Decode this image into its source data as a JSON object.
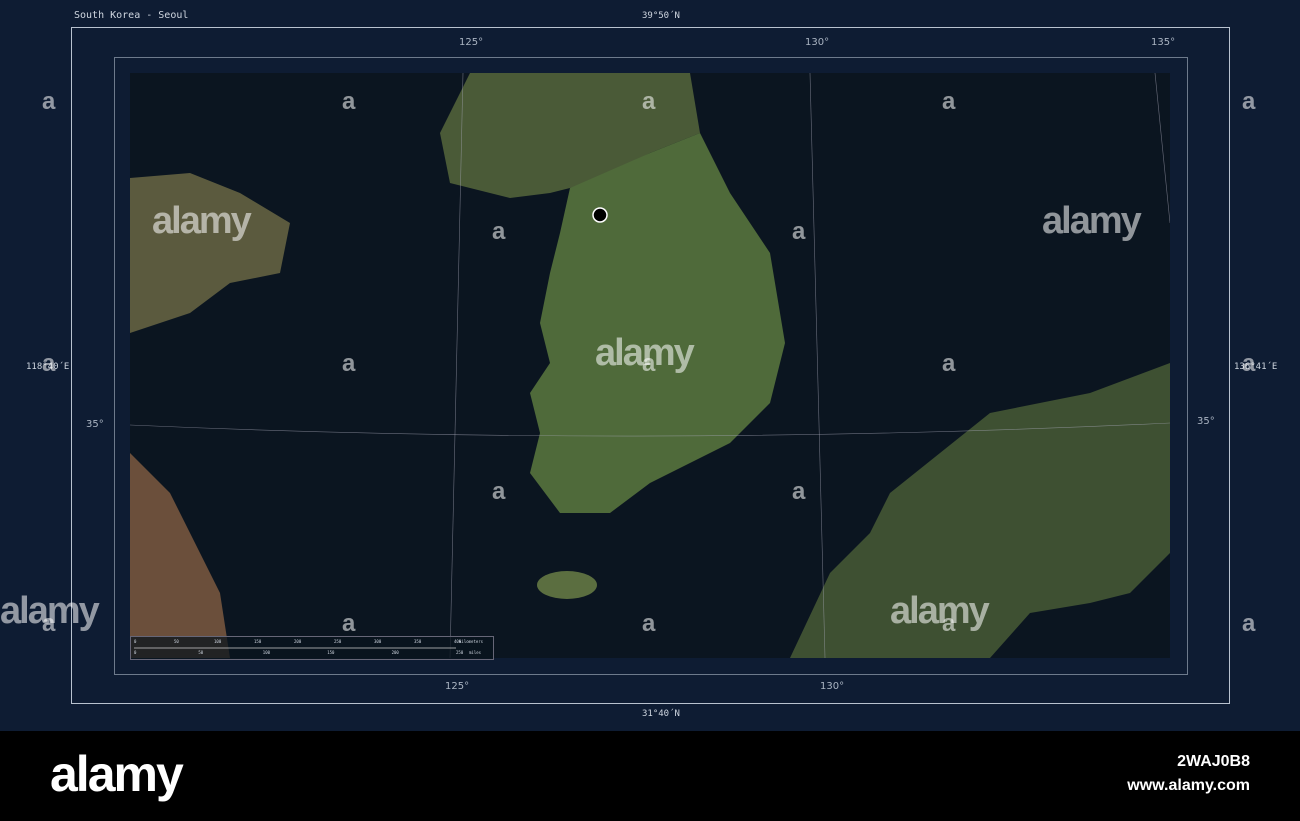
{
  "title": "South Korea - Seoul",
  "coords": {
    "top": "39°50´N",
    "bottom": "31°40´N",
    "left": "118°40´E",
    "right": "136°41´E"
  },
  "graticule": {
    "lon": [
      "125°",
      "130°",
      "135°"
    ],
    "lat": [
      "35°"
    ]
  },
  "scale": {
    "km_ticks": [
      "0",
      "50",
      "100",
      "150",
      "200",
      "250",
      "300",
      "350",
      "400"
    ],
    "km_unit": "kilometers",
    "mi_ticks": [
      "0",
      "50",
      "100",
      "150",
      "200",
      "250"
    ],
    "mi_unit": "miles"
  },
  "watermark": "alamy",
  "footer": {
    "logo": "alamy",
    "image_id": "2WAJ0B8",
    "url": "www.alamy.com"
  },
  "colors": {
    "frame": "#0e1c33",
    "ocean": "#0b1520",
    "land": "#4f6a3a"
  }
}
